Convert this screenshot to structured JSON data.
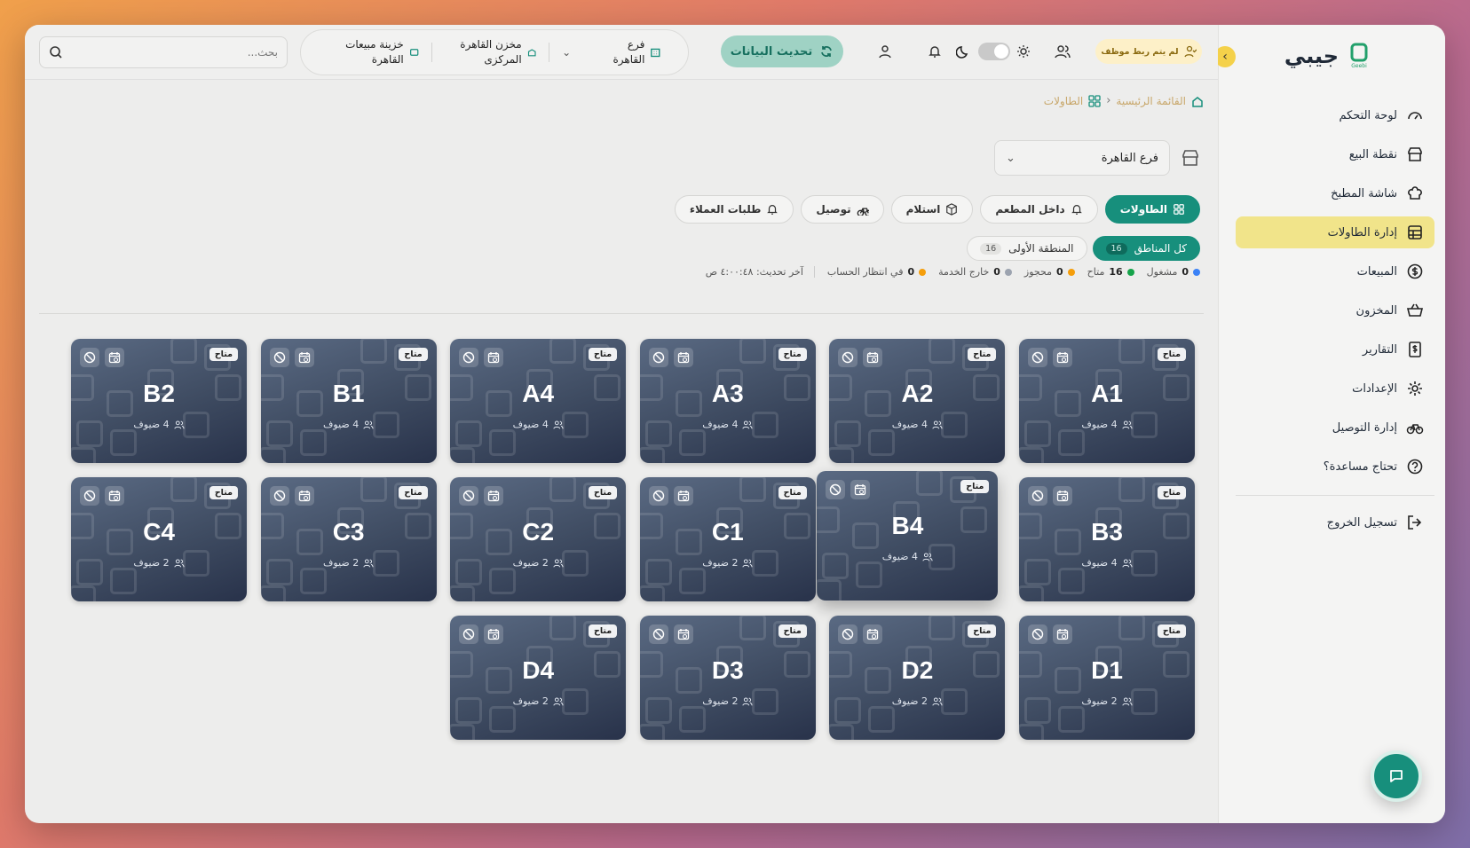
{
  "app": {
    "name": "جيبي",
    "logo_text": "Geebi"
  },
  "sidebar": {
    "items": [
      {
        "label": "لوحة التحكم",
        "icon": "gauge-icon"
      },
      {
        "label": "نقطة البيع",
        "icon": "store-icon"
      },
      {
        "label": "شاشة المطبخ",
        "icon": "chef-hat-icon"
      },
      {
        "label": "إدارة الطاولات",
        "icon": "table-grid-icon",
        "active": true
      },
      {
        "label": "المبيعات",
        "icon": "dollar-circle-icon"
      },
      {
        "label": "المخزون",
        "icon": "basket-icon"
      },
      {
        "label": "التقارير",
        "icon": "receipt-icon"
      },
      {
        "label": "الإعدادات",
        "icon": "gear-icon"
      },
      {
        "label": "إدارة التوصيل",
        "icon": "bike-icon"
      },
      {
        "label": "تحتاج مساعدة؟",
        "icon": "help-circle-icon"
      }
    ],
    "logout": "تسجيل الخروج"
  },
  "header": {
    "search_placeholder": "بحث...",
    "branch": "فرع القاهرة",
    "warehouse": "مخزن القاهرة المركزى",
    "treasury": "خزينة مبيعات القاهرة",
    "sync_label": "تحديث البيانات",
    "employee_badge": "لم يتم ربط موظف"
  },
  "breadcrumb": {
    "home": "القائمة الرئيسية",
    "current": "الطاولات"
  },
  "branch_select": {
    "value": "فرع القاهرة"
  },
  "tabs": [
    {
      "label": "الطاولات",
      "icon": "grid-icon",
      "active": true
    },
    {
      "label": "داخل المطعم",
      "icon": "bell-icon"
    },
    {
      "label": "استلام",
      "icon": "box-icon"
    },
    {
      "label": "توصيل",
      "icon": "bike-icon"
    },
    {
      "label": "طلبات العملاء",
      "icon": "bell-icon"
    }
  ],
  "zones": [
    {
      "label": "كل المناطق",
      "count": "16",
      "active": true
    },
    {
      "label": "المنطقة الأولى",
      "count": "16"
    }
  ],
  "stats": [
    {
      "count": "0",
      "label": "مشغول",
      "color": "#3b82f6"
    },
    {
      "count": "16",
      "label": "متاح",
      "color": "#16a34a"
    },
    {
      "count": "0",
      "label": "محجوز",
      "color": "#f59e0b"
    },
    {
      "count": "0",
      "label": "خارج الخدمة",
      "color": "#9ca3af"
    },
    {
      "count": "0",
      "label": "في انتظار الحساب",
      "color": "#f59e0b"
    }
  ],
  "last_update": "آخر تحديث: ٤:٠٠:٤٨ ص",
  "tables": [
    {
      "name": "A1",
      "guests": "4 ضيوف",
      "status": "متاح"
    },
    {
      "name": "A2",
      "guests": "4 ضيوف",
      "status": "متاح"
    },
    {
      "name": "A3",
      "guests": "4 ضيوف",
      "status": "متاح"
    },
    {
      "name": "A4",
      "guests": "4 ضيوف",
      "status": "متاح"
    },
    {
      "name": "B1",
      "guests": "4 ضيوف",
      "status": "متاح"
    },
    {
      "name": "B2",
      "guests": "4 ضيوف",
      "status": "متاح"
    },
    {
      "name": "B3",
      "guests": "4 ضيوف",
      "status": "متاح"
    },
    {
      "name": "B4",
      "guests": "4 ضيوف",
      "status": "متاح",
      "hovered": true
    },
    {
      "name": "C1",
      "guests": "2 ضيوف",
      "status": "متاح"
    },
    {
      "name": "C2",
      "guests": "2 ضيوف",
      "status": "متاح"
    },
    {
      "name": "C3",
      "guests": "2 ضيوف",
      "status": "متاح"
    },
    {
      "name": "C4",
      "guests": "2 ضيوف",
      "status": "متاح"
    },
    {
      "name": "D1",
      "guests": "2 ضيوف",
      "status": "متاح"
    },
    {
      "name": "D2",
      "guests": "2 ضيوف",
      "status": "متاح"
    },
    {
      "name": "D3",
      "guests": "2 ضيوف",
      "status": "متاح"
    },
    {
      "name": "D4",
      "guests": "2 ضيوف",
      "status": "متاح"
    }
  ],
  "colors": {
    "accent": "#178f7c",
    "active_nav": "#f1e48a",
    "card_top": "#5a6a83",
    "card_bottom": "#28324a"
  }
}
